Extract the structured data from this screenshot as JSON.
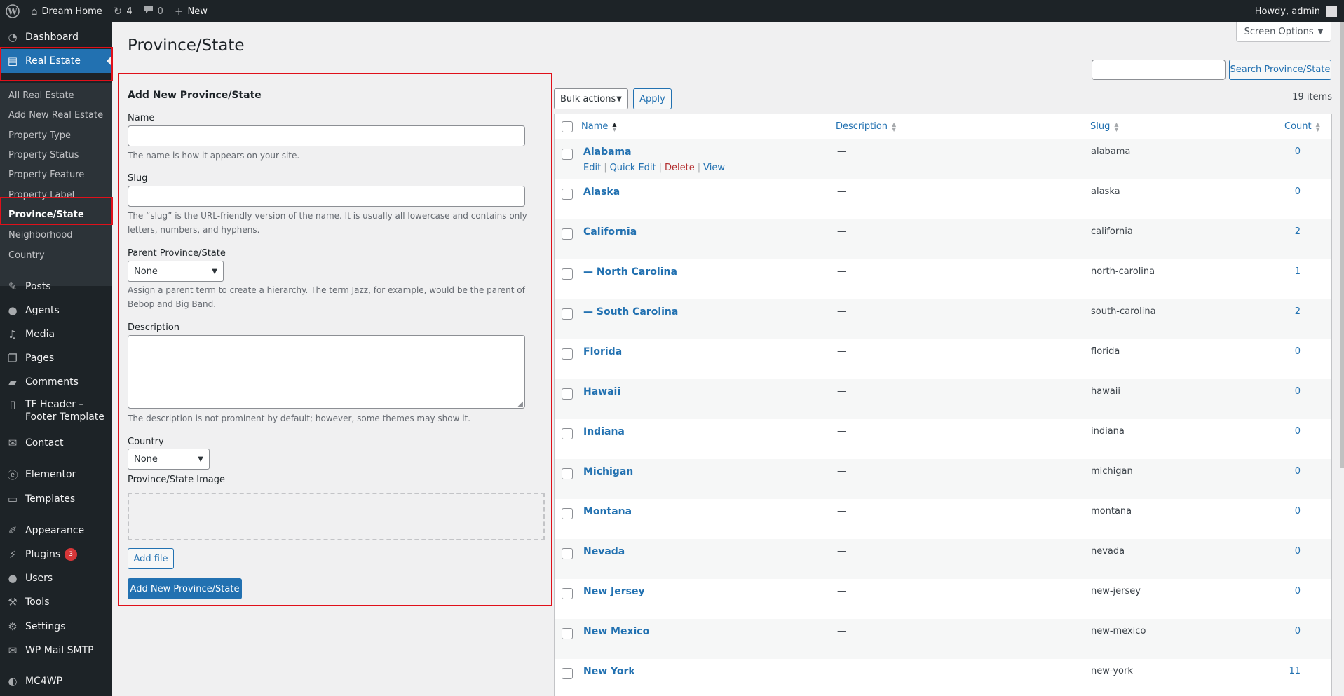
{
  "admin_bar": {
    "site_name": "Dream Home",
    "updates_count": "4",
    "comments_count": "0",
    "new_label": "New",
    "greeting": "Howdy, admin"
  },
  "sidebar": {
    "dashboard": "Dashboard",
    "real_estate": "Real Estate",
    "submenu": [
      "All Real Estate",
      "Add New Real Estate",
      "Property Type",
      "Property Status",
      "Property Feature",
      "Property Label",
      "Province/State",
      "Neighborhood",
      "Country"
    ],
    "posts": "Posts",
    "agents": "Agents",
    "media": "Media",
    "pages": "Pages",
    "comments": "Comments",
    "tf_header_1": "TF Header –",
    "tf_header_2": "Footer Template",
    "contact": "Contact",
    "elementor": "Elementor",
    "templates": "Templates",
    "appearance": "Appearance",
    "plugins": "Plugins",
    "plugins_badge": "3",
    "users": "Users",
    "tools": "Tools",
    "settings": "Settings",
    "wp_mail_smtp": "WP Mail SMTP",
    "mc4wp": "MC4WP"
  },
  "page": {
    "title": "Province/State",
    "screen_options": "Screen Options"
  },
  "form": {
    "heading": "Add New Province/State",
    "name_label": "Name",
    "name_help": "The name is how it appears on your site.",
    "slug_label": "Slug",
    "slug_help_1": "The “slug” is the URL-friendly version of the name. It is usually all lowercase and contains only",
    "slug_help_2": "letters, numbers, and hyphens.",
    "parent_label": "Parent Province/State",
    "parent_value": "None",
    "parent_help_1": "Assign a parent term to create a hierarchy. The term Jazz, for example, would be the parent of",
    "parent_help_2": "Bebop and Big Band.",
    "description_label": "Description",
    "description_help": "The description is not prominent by default; however, some themes may show it.",
    "country_label": "Country",
    "country_value": "None",
    "image_label": "Province/State Image",
    "add_file": "Add file",
    "submit": "Add New Province/State"
  },
  "list": {
    "search_button": "Search Province/State",
    "bulk_actions": "Bulk actions",
    "apply": "Apply",
    "items_count": "19 items",
    "headers": {
      "name": "Name",
      "description": "Description",
      "slug": "Slug",
      "count": "Count"
    },
    "row_actions": {
      "edit": "Edit",
      "quick_edit": "Quick Edit",
      "delete": "Delete",
      "view": "View"
    },
    "rows": [
      {
        "name": "Alabama",
        "description": "—",
        "slug": "alabama",
        "count": "0"
      },
      {
        "name": "Alaska",
        "description": "—",
        "slug": "alaska",
        "count": "0"
      },
      {
        "name": "California",
        "description": "—",
        "slug": "california",
        "count": "2"
      },
      {
        "name": "— North Carolina",
        "description": "—",
        "slug": "north-carolina",
        "count": "1"
      },
      {
        "name": "— South Carolina",
        "description": "—",
        "slug": "south-carolina",
        "count": "2"
      },
      {
        "name": "Florida",
        "description": "—",
        "slug": "florida",
        "count": "0"
      },
      {
        "name": "Hawaii",
        "description": "—",
        "slug": "hawaii",
        "count": "0"
      },
      {
        "name": "Indiana",
        "description": "—",
        "slug": "indiana",
        "count": "0"
      },
      {
        "name": "Michigan",
        "description": "—",
        "slug": "michigan",
        "count": "0"
      },
      {
        "name": "Montana",
        "description": "—",
        "slug": "montana",
        "count": "0"
      },
      {
        "name": "Nevada",
        "description": "—",
        "slug": "nevada",
        "count": "0"
      },
      {
        "name": "New Jersey",
        "description": "—",
        "slug": "new-jersey",
        "count": "0"
      },
      {
        "name": "New Mexico",
        "description": "—",
        "slug": "new-mexico",
        "count": "0"
      },
      {
        "name": "New York",
        "description": "—",
        "slug": "new-york",
        "count": "11"
      }
    ]
  }
}
